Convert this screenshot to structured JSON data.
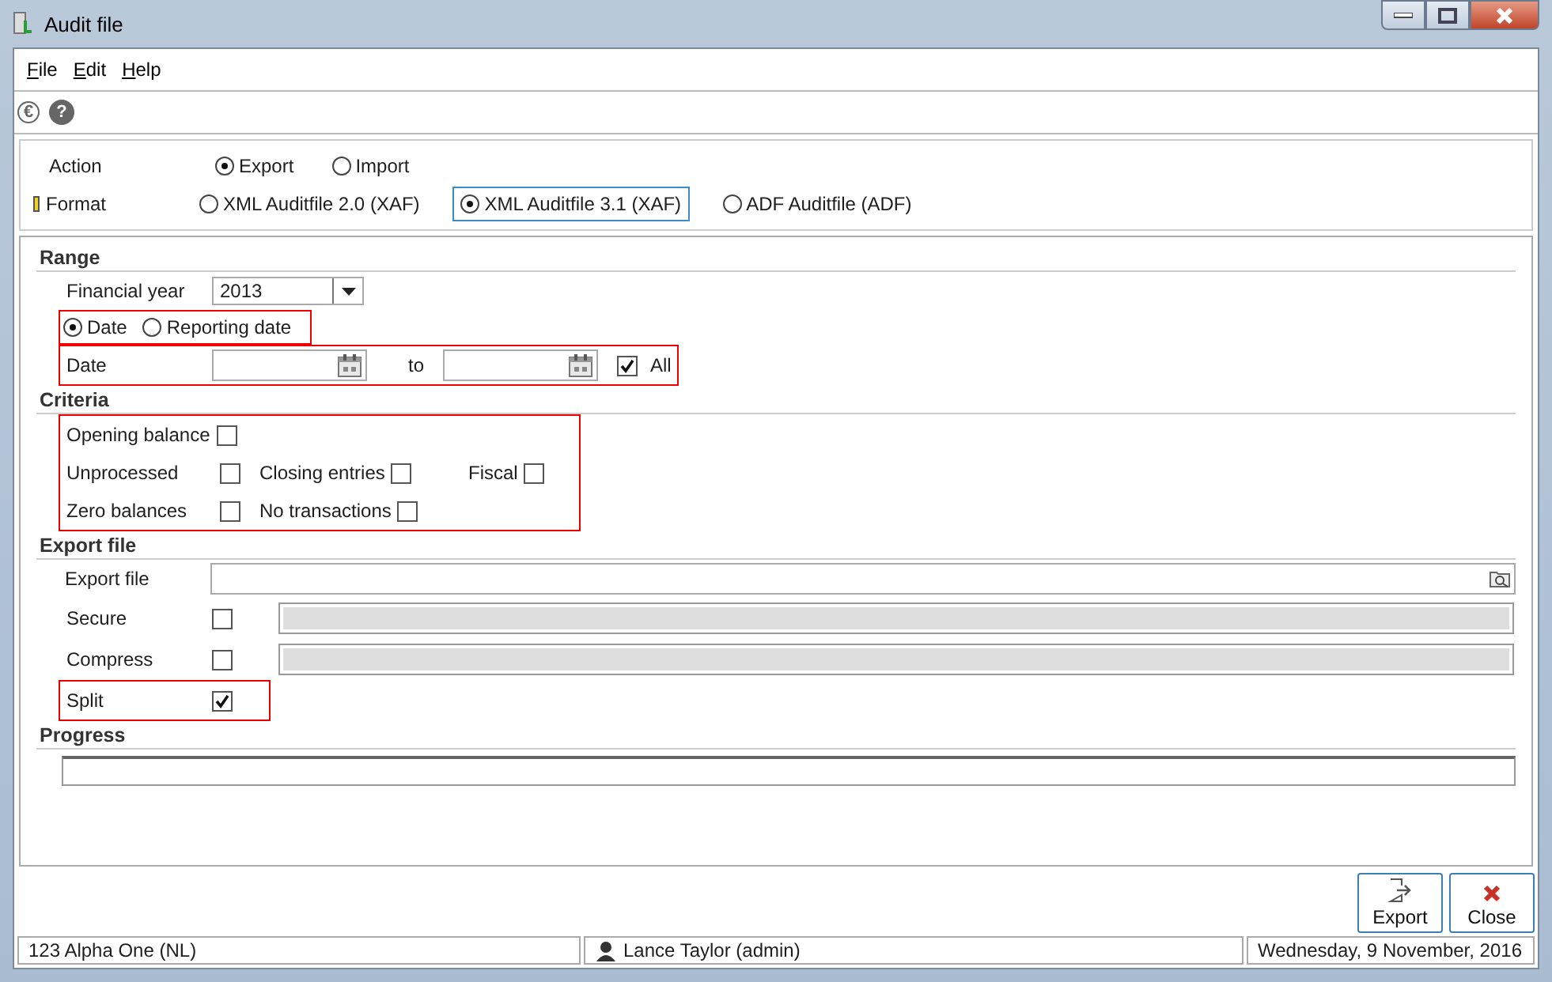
{
  "window": {
    "title": "Audit file"
  },
  "menu": [
    {
      "label": "File"
    },
    {
      "label": "Edit"
    },
    {
      "label": "Help"
    }
  ],
  "toolbar": [
    {
      "glyph": "€",
      "kind": "euro"
    },
    {
      "glyph": "?",
      "kind": "help"
    }
  ],
  "action": {
    "label": "Action",
    "options": [
      {
        "label": "Export",
        "selected": true
      },
      {
        "label": "Import",
        "selected": false
      }
    ]
  },
  "format": {
    "label": "Format",
    "options": [
      {
        "label": "XML Auditfile 2.0 (XAF)",
        "selected": false,
        "focused": false
      },
      {
        "label": "XML Auditfile 3.1 (XAF)",
        "selected": true,
        "focused": true
      },
      {
        "label": "ADF Auditfile (ADF)",
        "selected": false,
        "focused": false
      }
    ]
  },
  "range": {
    "title": "Range",
    "financial_year": {
      "label": "Financial year",
      "value": "2013"
    },
    "date_mode": {
      "highlighted": true,
      "options": [
        {
          "label": "Date",
          "selected": true
        },
        {
          "label": "Reporting date",
          "selected": false
        }
      ]
    },
    "date": {
      "highlighted": true,
      "label": "Date",
      "to_label": "to",
      "all": {
        "label": "All",
        "checked": true
      }
    }
  },
  "criteria": {
    "title": "Criteria",
    "highlighted": true,
    "rows": [
      [
        {
          "label": "Opening balance",
          "checked": false
        }
      ],
      [
        {
          "label": "Unprocessed",
          "checked": false
        },
        {
          "label": "Closing entries",
          "checked": false
        },
        {
          "label": "Fiscal",
          "checked": false
        }
      ],
      [
        {
          "label": "Zero balances",
          "checked": false
        },
        {
          "label": "No transactions",
          "checked": false
        }
      ]
    ]
  },
  "export_file": {
    "title": "Export file",
    "fields": [
      {
        "kind": "path",
        "label": "Export file"
      },
      {
        "kind": "option",
        "label": "Secure",
        "checked": false,
        "highlighted": false
      },
      {
        "kind": "option",
        "label": "Compress",
        "checked": false,
        "highlighted": false
      },
      {
        "kind": "flag",
        "label": "Split",
        "checked": true,
        "highlighted": true
      }
    ]
  },
  "progress": {
    "title": "Progress",
    "level": 0
  },
  "buttons": [
    {
      "kind": "export",
      "label": "Export"
    },
    {
      "kind": "close",
      "label": "Close"
    }
  ],
  "status_bar": {
    "company": "123 Alpha One (NL)",
    "user": "Lance Taylor (admin)",
    "date": "Wednesday, 9 November, 2016"
  }
}
